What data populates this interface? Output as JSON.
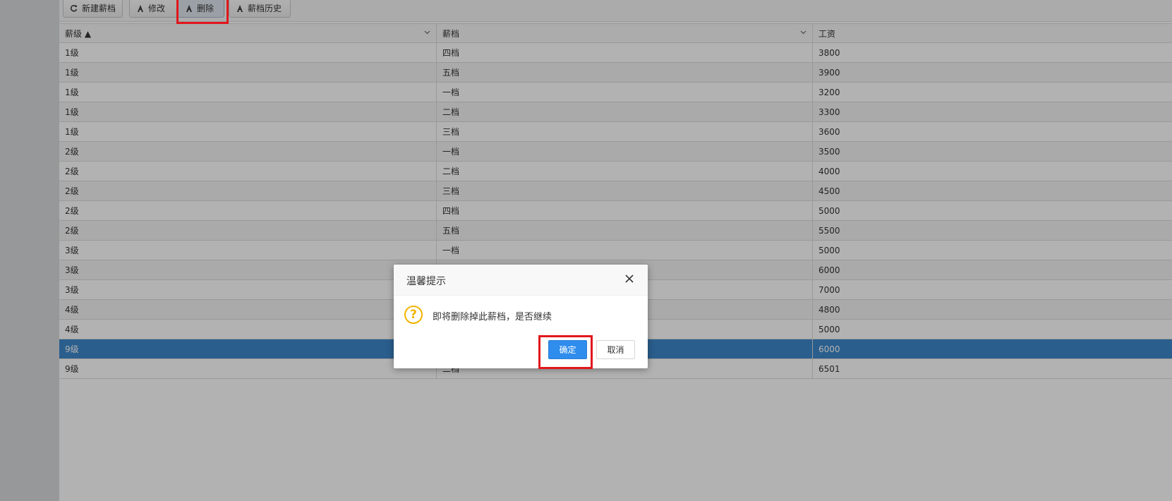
{
  "toolbar": {
    "buttons": [
      {
        "label": "新建薪档",
        "icon": "refresh-icon"
      },
      {
        "label": "修改",
        "icon": "edit-icon"
      },
      {
        "label": "删除",
        "icon": "delete-icon"
      },
      {
        "label": "薪档历史",
        "icon": "history-icon"
      }
    ]
  },
  "grid": {
    "columns": [
      {
        "label": "薪级 ▲"
      },
      {
        "label": "薪档"
      },
      {
        "label": "工资"
      }
    ],
    "rows": [
      [
        "1级",
        "四档",
        "3800"
      ],
      [
        "1级",
        "五档",
        "3900"
      ],
      [
        "1级",
        "一档",
        "3200"
      ],
      [
        "1级",
        "二档",
        "3300"
      ],
      [
        "1级",
        "三档",
        "3600"
      ],
      [
        "2级",
        "一档",
        "3500"
      ],
      [
        "2级",
        "二档",
        "4000"
      ],
      [
        "2级",
        "三档",
        "4500"
      ],
      [
        "2级",
        "四档",
        "5000"
      ],
      [
        "2级",
        "五档",
        "5500"
      ],
      [
        "3级",
        "一档",
        "5000"
      ],
      [
        "3级",
        "",
        "6000"
      ],
      [
        "3级",
        "",
        "7000"
      ],
      [
        "4级",
        "",
        "4800"
      ],
      [
        "4级",
        "",
        "5000"
      ],
      [
        "9级",
        "",
        "6000"
      ],
      [
        "9级",
        "二档",
        "6501"
      ]
    ],
    "selected_row_index": 15
  },
  "dialog": {
    "title": "温馨提示",
    "message": "即将删除掉此薪档，是否继续",
    "ok_label": "确定",
    "cancel_label": "取消"
  },
  "colors": {
    "highlight": "#e1161c",
    "primary": "#2e8ded",
    "selected_row": "#3d87cb",
    "warning_icon": "#f0b400"
  }
}
